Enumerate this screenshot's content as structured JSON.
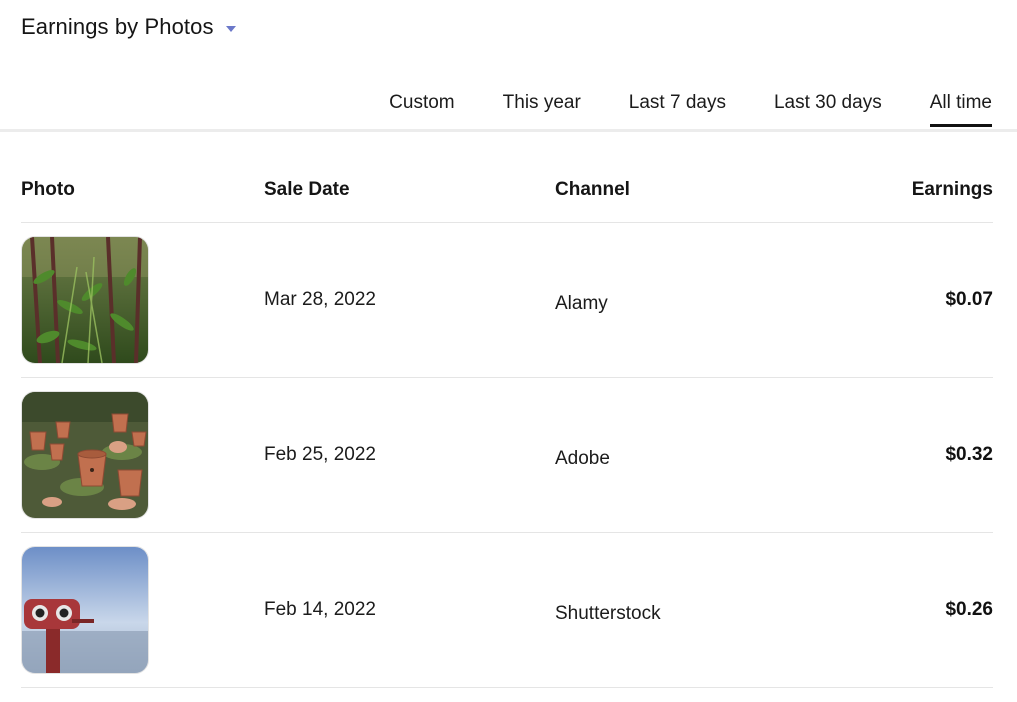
{
  "header": {
    "title": "Earnings by Photos",
    "dropdown_icon": "caret-down-icon",
    "accent": "#6b78c9"
  },
  "tabs": [
    {
      "label": "Custom"
    },
    {
      "label": "This year"
    },
    {
      "label": "Last 7 days"
    },
    {
      "label": "Last 30 days"
    },
    {
      "label": "All time",
      "active": true
    }
  ],
  "table": {
    "columns": [
      "Photo",
      "Sale Date",
      "Channel",
      "Earnings"
    ],
    "rows": [
      {
        "photo": "bamboo-plants-photo",
        "sale_date": "Mar 28, 2022",
        "channel": "Alamy",
        "earnings": "$0.07"
      },
      {
        "photo": "clay-pots-photo",
        "sale_date": "Feb 25, 2022",
        "channel": "Adobe",
        "earnings": "$0.32"
      },
      {
        "photo": "coin-binoculars-photo",
        "sale_date": "Feb 14, 2022",
        "channel": "Shutterstock",
        "earnings": "$0.26"
      }
    ]
  }
}
